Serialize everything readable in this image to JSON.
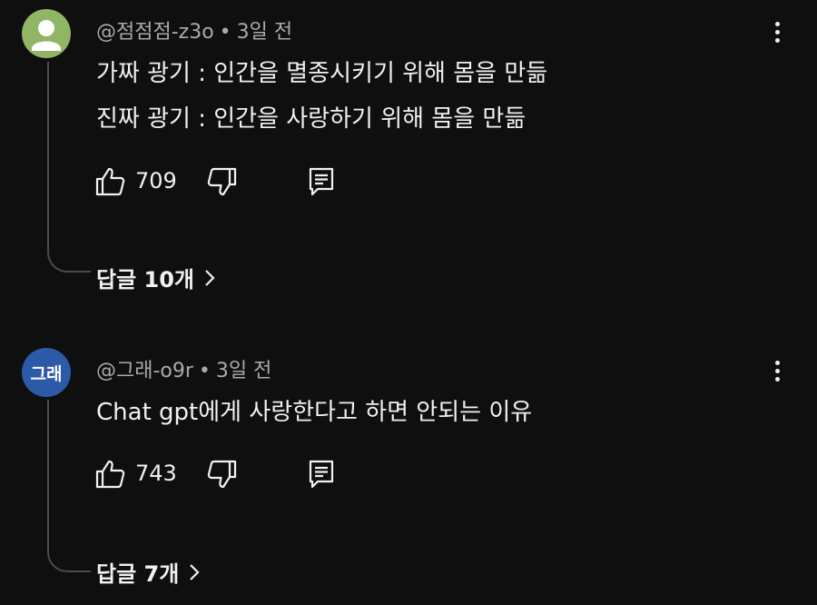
{
  "comments": [
    {
      "author": "@점점점-z3o",
      "separator": "•",
      "time": "3일 전",
      "avatar_text": "",
      "lines": [
        "가짜 광기 : 인간을 멸종시키기 위해 몸을 만듦",
        "진짜 광기 : 인간을 사랑하기 위해 몸을 만듦"
      ],
      "likes": "709",
      "replies_label": "답글 10개"
    },
    {
      "author": "@그래-o9r",
      "separator": "•",
      "time": "3일 전",
      "avatar_text": "그래",
      "lines": [
        "Chat gpt에게 사랑한다고 하면 안되는 이유"
      ],
      "likes": "743",
      "replies_label": "답글 7개"
    }
  ],
  "icons": {
    "like": "thumbs-up-icon",
    "dislike": "thumbs-down-icon",
    "reply": "reply-icon",
    "more": "more-vertical-icon",
    "chevron": "chevron-right-icon"
  },
  "colors": {
    "background": "#0f0f0f",
    "text": "#f1f1f1",
    "meta": "#aaaaaa",
    "avatar1": "#8fb565",
    "avatar2": "#2c5aa7"
  }
}
